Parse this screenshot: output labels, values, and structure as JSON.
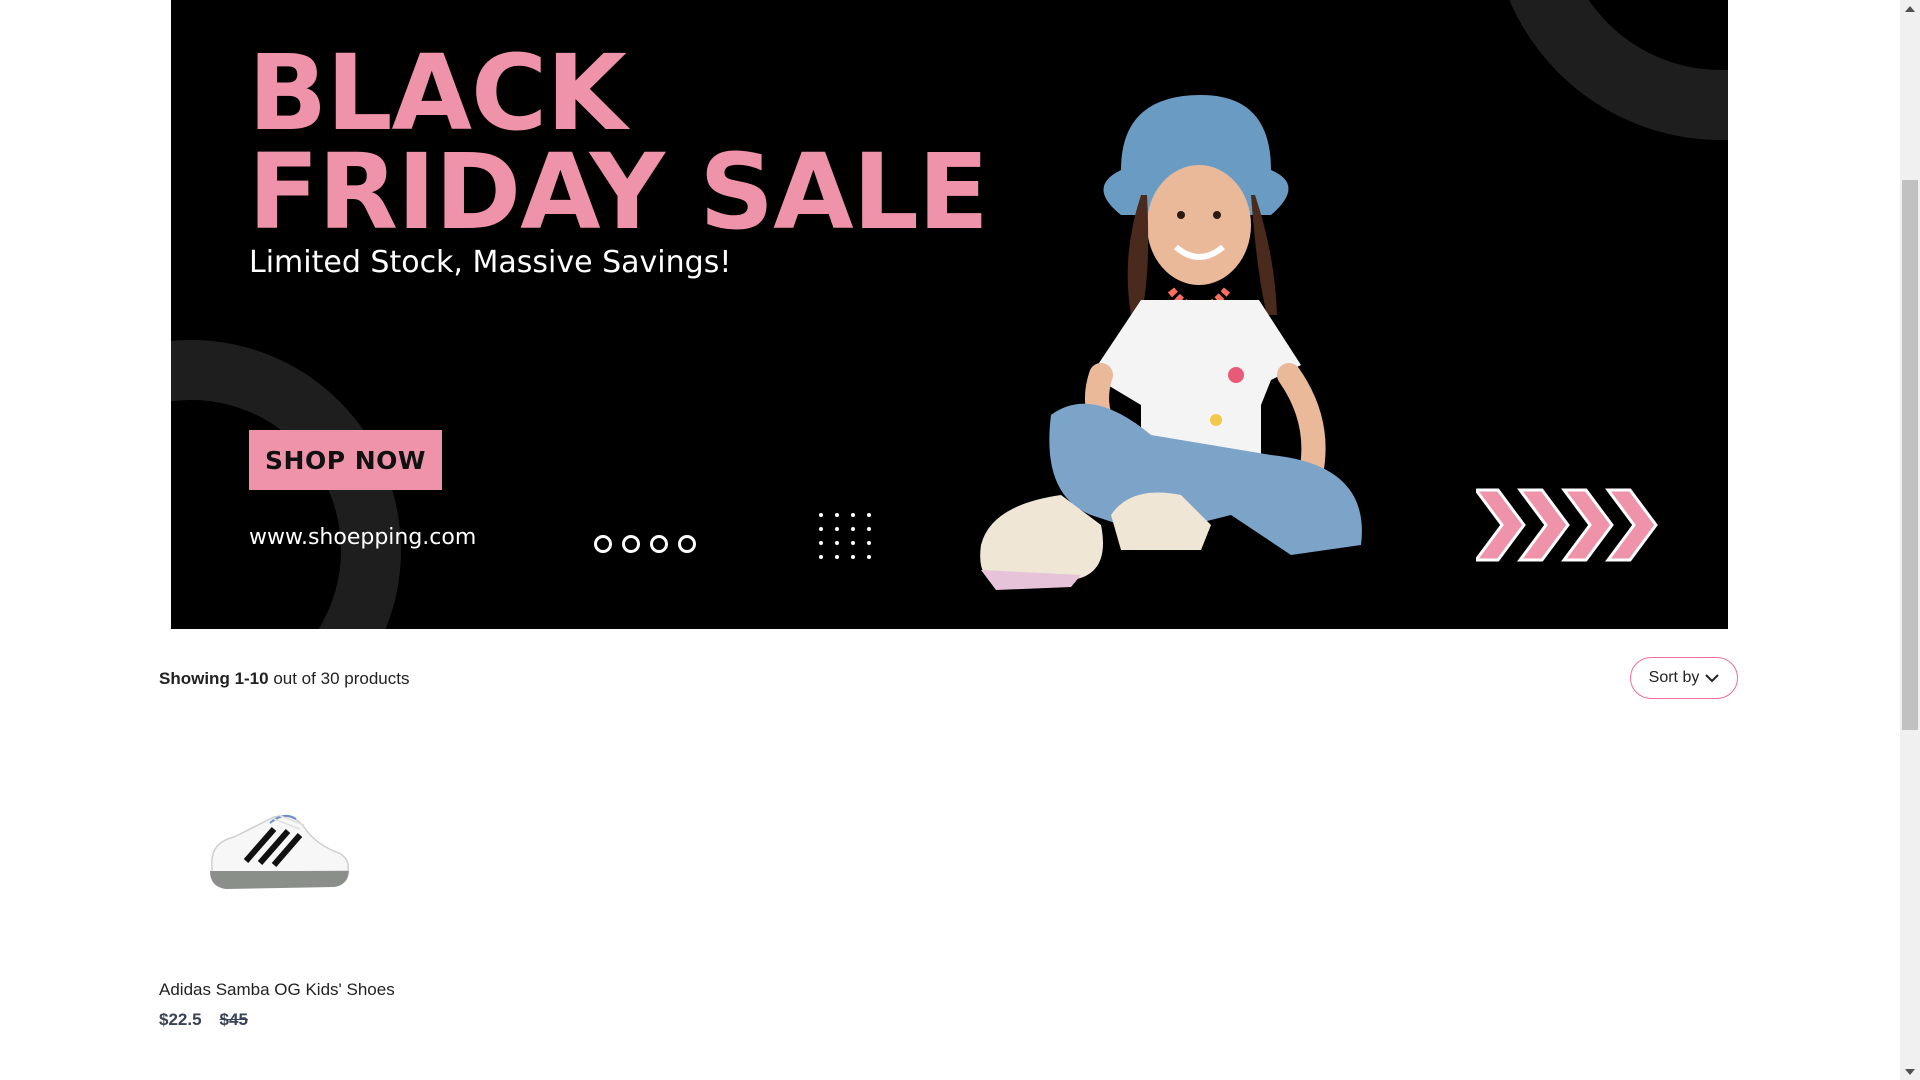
{
  "banner": {
    "headline_line1": "BLACK",
    "headline_line2": "FRIDAY SALE",
    "tagline": "Limited Stock, Massive Savings!",
    "cta_label": "SHOP NOW",
    "url": "www.shoepping.com",
    "slide_count": 4,
    "accent_color": "#ef93ab",
    "background_color": "#000000"
  },
  "listing": {
    "showing_label": "Showing",
    "showing_range": "1-10",
    "out_of_label": "out of",
    "total": "30",
    "products_label": "products",
    "sort_label": "Sort by",
    "sort_icon": "chevron-down-icon"
  },
  "products": [
    {
      "name": "Adidas Samba OG Kids' Shoes",
      "price": "$22.5",
      "original_price": "$45"
    }
  ],
  "colors": {
    "sort_border": "#ef6f96",
    "price_text": "#3a4256"
  }
}
